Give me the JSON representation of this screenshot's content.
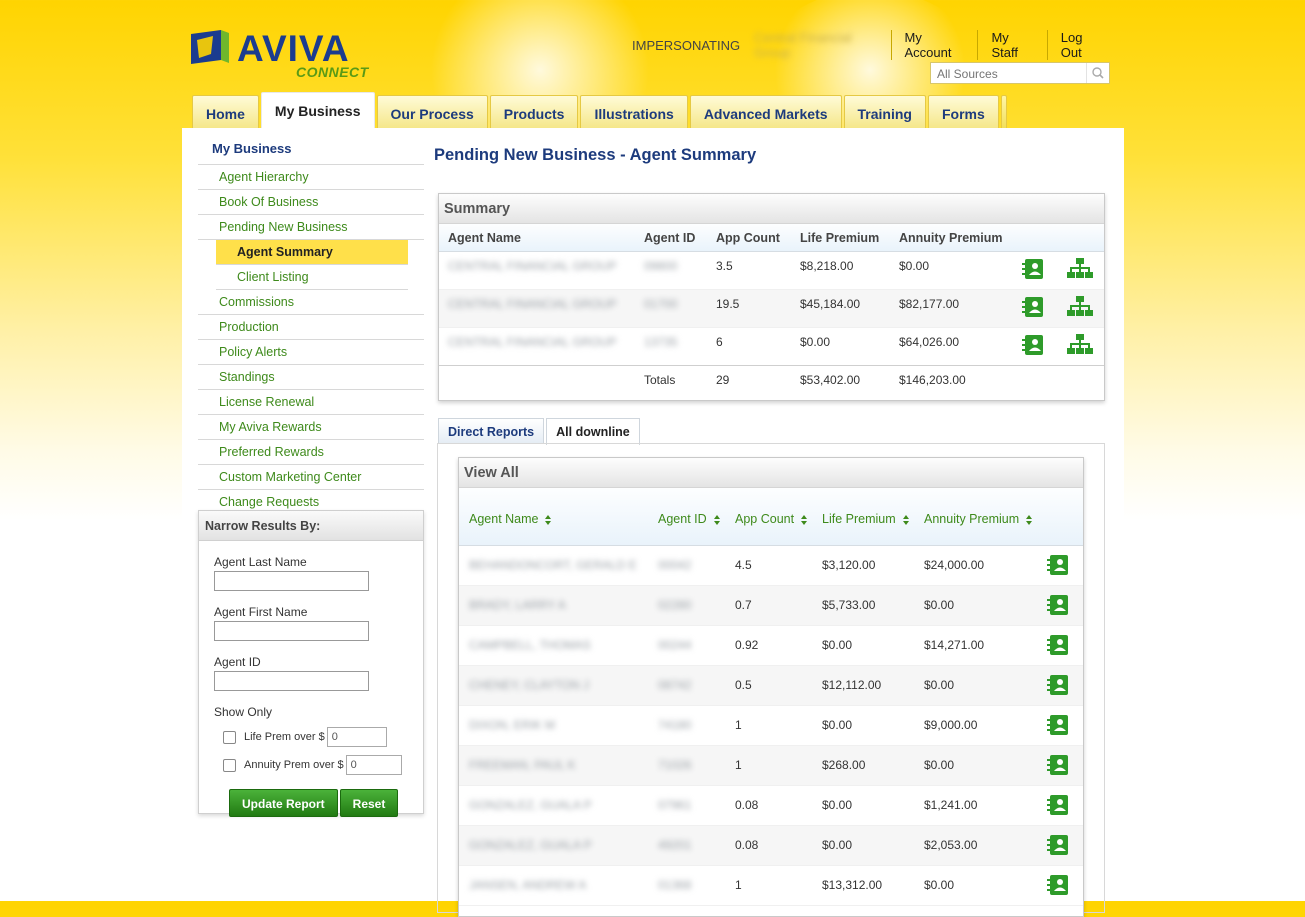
{
  "header": {
    "brand": "AVIVA",
    "brand_sub": "CONNECT",
    "impersonating_label": "IMPERSONATING",
    "impersonating_name": "Central Financial Group",
    "links": [
      "My Account",
      "My Staff",
      "Log Out"
    ],
    "search_placeholder": "All Sources"
  },
  "main_tabs": [
    "Home",
    "My Business",
    "Our Process",
    "Products",
    "Illustrations",
    "Advanced Markets",
    "Training",
    "Forms"
  ],
  "active_tab": "My Business",
  "sidebar": {
    "heading": "My Business",
    "items": [
      "Agent Hierarchy",
      "Book Of Business",
      "Pending New Business"
    ],
    "sub_items": [
      "Agent Summary",
      "Client Listing"
    ],
    "items2": [
      "Commissions",
      "Production",
      "Policy Alerts",
      "Standings",
      "License Renewal",
      "My Aviva Rewards",
      "Preferred Rewards",
      "Custom Marketing Center",
      "Change Requests"
    ]
  },
  "narrow": {
    "title": "Narrow Results By:",
    "last_name_label": "Agent Last Name",
    "first_name_label": "Agent First Name",
    "agent_id_label": "Agent ID",
    "show_only": "Show Only",
    "life_prem_label": "Life Prem over $",
    "life_prem_value": "0",
    "annuity_prem_label": "Annuity Prem over $",
    "annuity_prem_value": "0",
    "update_button": "Update Report",
    "reset_button": "Reset"
  },
  "page_title": "Pending New Business - Agent Summary",
  "summary": {
    "title": "Summary",
    "columns": [
      "Agent Name",
      "Agent ID",
      "App Count",
      "Life Premium",
      "Annuity Premium"
    ],
    "rows": [
      {
        "name": "CENTRAL FINANCIAL GROUP",
        "id": "09800",
        "count": "3.5",
        "life": "$8,218.00",
        "annuity": "$0.00"
      },
      {
        "name": "CENTRAL FINANCIAL GROUP",
        "id": "01700",
        "count": "19.5",
        "life": "$45,184.00",
        "annuity": "$82,177.00"
      },
      {
        "name": "CENTRAL FINANCIAL GROUP",
        "id": "13735",
        "count": "6",
        "life": "$0.00",
        "annuity": "$64,026.00"
      }
    ],
    "totals_label": "Totals",
    "totals": {
      "count": "29",
      "life": "$53,402.00",
      "annuity": "$146,203.00"
    }
  },
  "downline_tabs": [
    "Direct Reports",
    "All downline"
  ],
  "view_all": {
    "title": "View All",
    "columns": [
      "Agent Name",
      "Agent ID",
      "App Count",
      "Life Premium",
      "Annuity Premium"
    ],
    "rows": [
      {
        "name": "BEHANDONCORT, GERALD E",
        "id": "00042",
        "count": "4.5",
        "life": "$3,120.00",
        "annuity": "$24,000.00"
      },
      {
        "name": "BRADY, LARRY A",
        "id": "02280",
        "count": "0.7",
        "life": "$5,733.00",
        "annuity": "$0.00"
      },
      {
        "name": "CAMPBELL, THOMAS",
        "id": "00244",
        "count": "0.92",
        "life": "$0.00",
        "annuity": "$14,271.00"
      },
      {
        "name": "CHENEY, CLAYTON J",
        "id": "08742",
        "count": "0.5",
        "life": "$12,112.00",
        "annuity": "$0.00"
      },
      {
        "name": "DIXON, ERIK M",
        "id": "74180",
        "count": "1",
        "life": "$0.00",
        "annuity": "$9,000.00"
      },
      {
        "name": "FREEMAN, PAUL K",
        "id": "71026",
        "count": "1",
        "life": "$268.00",
        "annuity": "$0.00"
      },
      {
        "name": "GONZALEZ, GUALA P",
        "id": "07961",
        "count": "0.08",
        "life": "$0.00",
        "annuity": "$1,241.00"
      },
      {
        "name": "GONZALEZ, GUALA P",
        "id": "49201",
        "count": "0.08",
        "life": "$0.00",
        "annuity": "$2,053.00"
      },
      {
        "name": "JANSEN, ANDREW A",
        "id": "01368",
        "count": "1",
        "life": "$13,312.00",
        "annuity": "$0.00"
      }
    ]
  },
  "colors": {
    "brand_blue": "#1b3c8f",
    "link_green": "#3e8a1b",
    "accent_yellow": "#ffd400"
  }
}
